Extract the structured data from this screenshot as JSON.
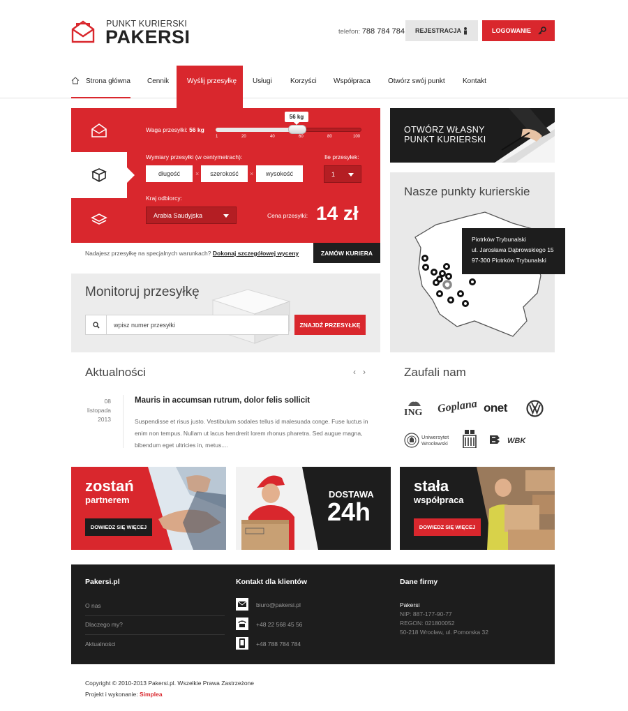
{
  "brand": {
    "sub": "Punkt kurierski",
    "name": "PAKERSI"
  },
  "header": {
    "phone_label": "telefon:",
    "phone": "788 784 784",
    "register": "REJESTRACJA",
    "login": "LOGOWANIE"
  },
  "nav": {
    "items": [
      {
        "label": "Strona główna"
      },
      {
        "label": "Cennik"
      },
      {
        "label": "Wyślij przesyłkę"
      },
      {
        "label": "Usługi"
      },
      {
        "label": "Korzyści"
      },
      {
        "label": "Współpraca"
      },
      {
        "label": "Otwórz swój punkt"
      },
      {
        "label": "Kontakt"
      }
    ],
    "active_index": 2
  },
  "calc": {
    "weight_label": "Waga przesyłki:",
    "weight_value": "56 kg",
    "slider_tip": "56 kg",
    "slider_value": 56,
    "slider_max": 100,
    "ticks": [
      "1",
      "20",
      "40",
      "60",
      "80",
      "100"
    ],
    "dims_label": "Wymiary przesyłki (w centymetrach):",
    "dims": [
      "długość",
      "szerokość",
      "wysokość"
    ],
    "count_label": "Ile przesyłek:",
    "count_value": "1",
    "country_label": "Kraj odbiorcy:",
    "country_value": "Arabia Saudyjska",
    "price_label": "Cena przesyłki:",
    "price": "14 zł"
  },
  "special": {
    "text": "Nadajesz przesyłkę na specjalnych warunkach?",
    "link": "Dokonaj szczegółowej wyceny",
    "button": "ZAMÓW KURIERA"
  },
  "track": {
    "title": "Monitoruj przesyłkę",
    "placeholder": "wpisz numer przesyłki",
    "button": "ZNAJDŹ PRZESYŁKĘ"
  },
  "own_point": {
    "line1": "OTWÓRZ WŁASNY",
    "line2": "PUNKT KURIERSKI"
  },
  "points": {
    "title": "Nasze punkty kurierskie",
    "tooltip": {
      "city": "Piotrków Trybunalski",
      "street": "ul. Jarosława Dąbrowskiego 15",
      "zip": "97-300 Piotrków Trybunalski"
    }
  },
  "news": {
    "title": "Aktualności",
    "prev": "‹",
    "next": "›",
    "day": "08",
    "month": "listopada",
    "year": "2013",
    "headline": "Mauris in accumsan rutrum, dolor felis sollicit",
    "body": "Suspendisse et risus justo. Vestibulum sodales tellus id malesuada conge. Fuse luctus in enim non tempus. Nullam ut lacus hendrerit lorem rhonus pharetra. Sed augue magna, bibendum eget ultricies in, metus...."
  },
  "trust": {
    "title": "Zaufali nam",
    "logos": [
      "ING",
      "Goplana",
      "onet",
      "VW",
      "Uniwersytet Wrocławski",
      "PKO",
      "WBK"
    ],
    "uni_line1": "Uniwersytet",
    "uni_line2": "Wrocławski"
  },
  "banners": [
    {
      "title1": "zostań",
      "title2": "partnerem",
      "button": "DOWIEDZ SIĘ WIĘCEJ"
    },
    {
      "title1": "DOSTAWA",
      "title2": "24h"
    },
    {
      "title1": "stała",
      "title2": "współpraca",
      "button": "DOWIEDZ SIĘ WIĘCEJ"
    }
  ],
  "footer": {
    "col1": {
      "title": "Pakersi.pl",
      "links": [
        "O nas",
        "Dlaczego my?",
        "Aktualności"
      ]
    },
    "col2": {
      "title": "Kontakt dla klientów",
      "email": "biuro@pakersi.pl",
      "phone": "+48 22 568 45 56",
      "mobile": "+48 788 784 784"
    },
    "col3": {
      "title": "Dane firmy",
      "name": "Pakersi",
      "nip": "NIP: 887-177-90-77",
      "regon": "REGON: 021800052",
      "address": "50-218 Wrocław, ul. Pomorska 32"
    },
    "copyright": "Copyright © 2010-2013 Pakersi.pl. Wszelkie Prawa Zastrzeżone",
    "credit_label": "Projekt i wykonanie:",
    "credit": "Simplea"
  },
  "colors": {
    "accent": "#d9272d",
    "dark": "#1d1d1d",
    "light": "#ececec"
  }
}
